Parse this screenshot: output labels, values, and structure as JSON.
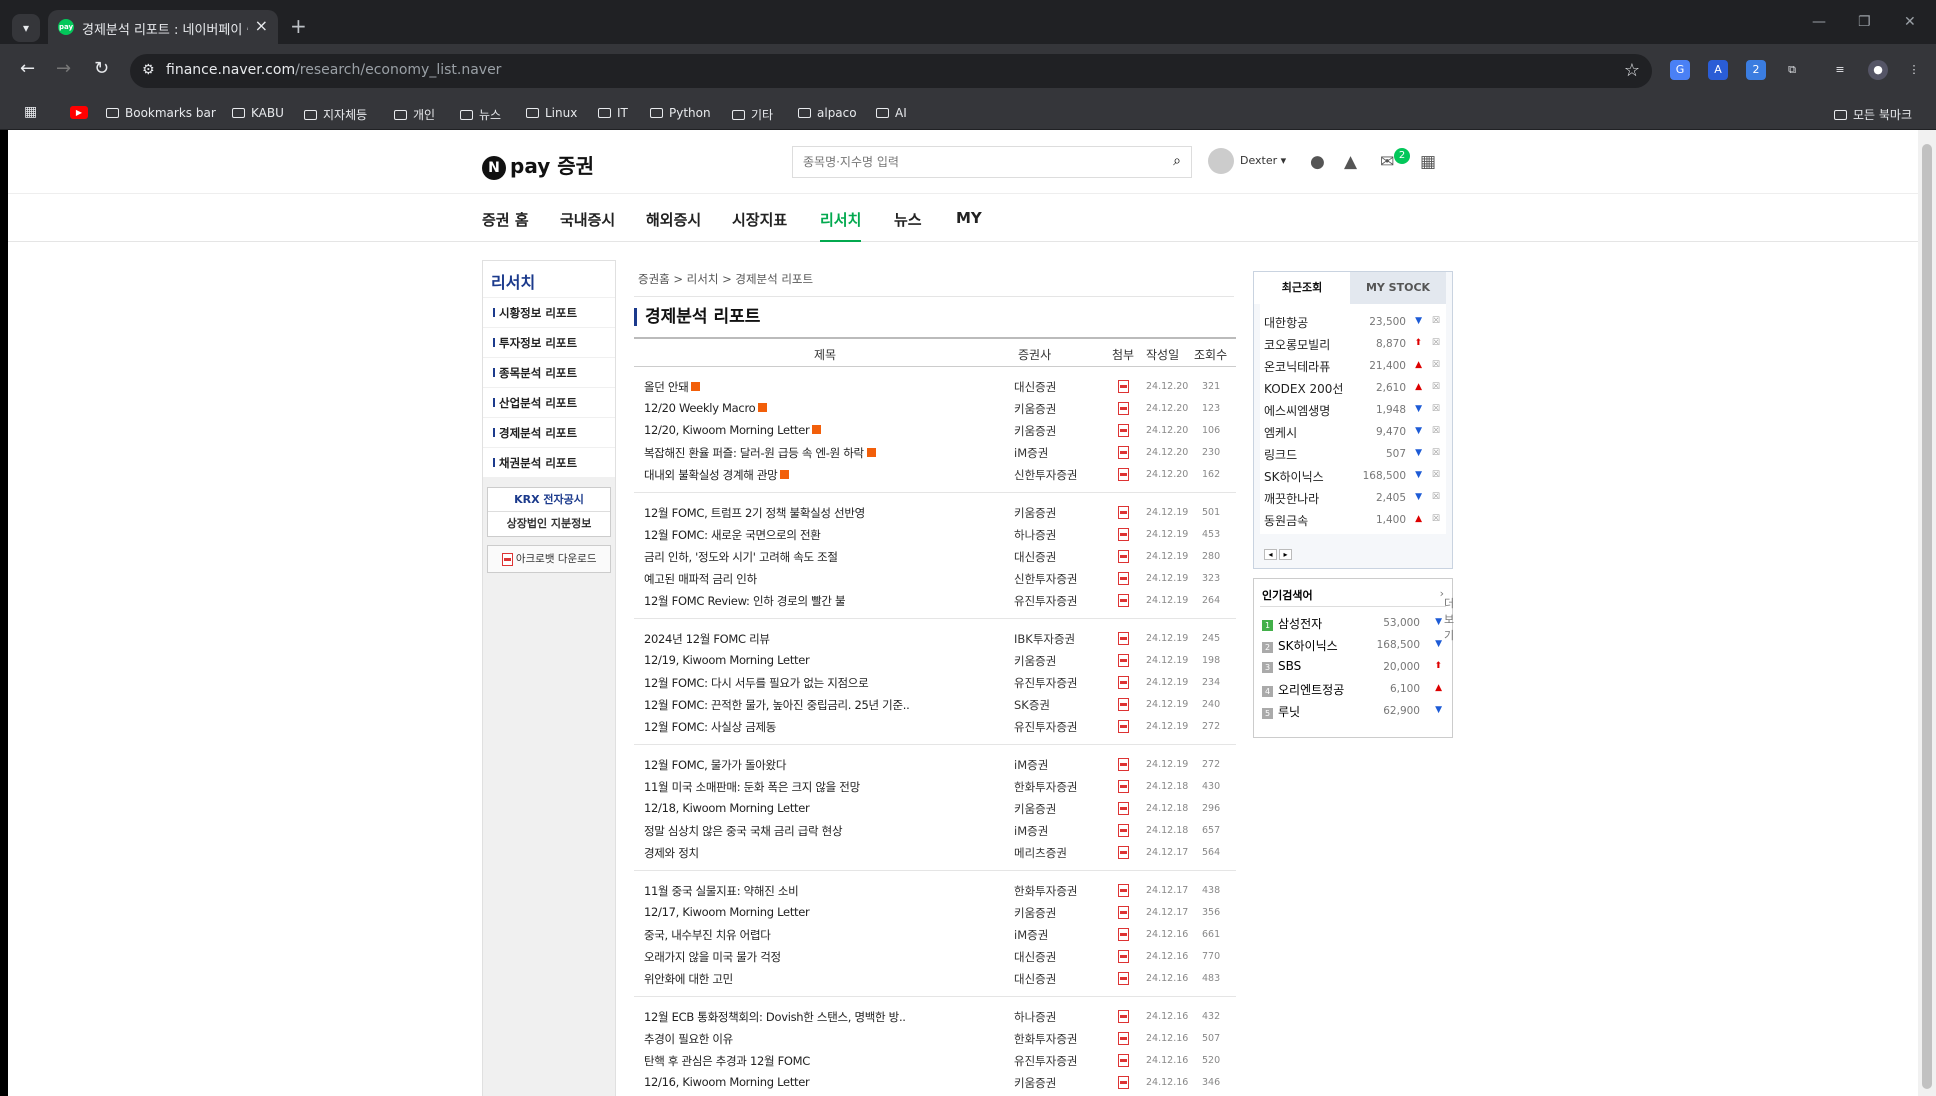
{
  "browser": {
    "tab_title": "경제분석 리포트 : 네이버페이 증권",
    "url_host": "finance.naver.com",
    "url_path": "/research/economy_list.naver",
    "bookmarks": [
      "Bookmarks bar",
      "KABU",
      "지자체등",
      "개인",
      "뉴스",
      "Linux",
      "IT",
      "Python",
      "기타",
      "alpaco",
      "AI"
    ],
    "bookmarks_right": "모든 북마크"
  },
  "header": {
    "logo": "pay 증권",
    "search_placeholder": "종목명·지수명 입력",
    "user": "Dexter",
    "mail_badge": "2"
  },
  "gnb": [
    "증권 홈",
    "국내증시",
    "해외증시",
    "시장지표",
    "리서치",
    "뉴스",
    "MY"
  ],
  "lnb": {
    "title": "리서치",
    "items": [
      "시황정보 리포트",
      "투자정보 리포트",
      "종목분석 리포트",
      "산업분석 리포트",
      "경제분석 리포트",
      "채권분석 리포트"
    ],
    "krx": "KRX 전자공시",
    "listed": "상장법인 지분정보",
    "acrobat": "아크로뱃 다운로드"
  },
  "breadcrumb": "증권홈 > 리서치 > 경제분석 리포트",
  "page_title": "경제분석 리포트",
  "table": {
    "headers": [
      "제목",
      "증권사",
      "첨부",
      "작성일",
      "조회수"
    ],
    "groups": [
      [
        {
          "t": "올던 안돼",
          "b": "대신증권",
          "d": "24.12.20",
          "v": "321",
          "n": true
        },
        {
          "t": "12/20 Weekly Macro",
          "b": "키움증권",
          "d": "24.12.20",
          "v": "123",
          "n": true
        },
        {
          "t": "12/20, Kiwoom Morning Letter",
          "b": "키움증권",
          "d": "24.12.20",
          "v": "106",
          "n": true
        },
        {
          "t": "복잡해진 환율 퍼즐: 달러-원 급등 속 엔-원 하락",
          "b": "iM증권",
          "d": "24.12.20",
          "v": "230",
          "n": true
        },
        {
          "t": "대내외 불확실성 경계해 관망",
          "b": "신한투자증권",
          "d": "24.12.20",
          "v": "162",
          "n": true
        }
      ],
      [
        {
          "t": "12월 FOMC, 트럼프 2기 정책 불확실성 선반영",
          "b": "키움증권",
          "d": "24.12.19",
          "v": "501"
        },
        {
          "t": "12월 FOMC: 새로운 국면으로의 전환",
          "b": "하나증권",
          "d": "24.12.19",
          "v": "453"
        },
        {
          "t": "금리 인하, '정도와 시기' 고려해 속도 조절",
          "b": "대신증권",
          "d": "24.12.19",
          "v": "280"
        },
        {
          "t": "예고된 매파적 금리 인하",
          "b": "신한투자증권",
          "d": "24.12.19",
          "v": "323"
        },
        {
          "t": "12월 FOMC Review: 인하 경로의 빨간 불",
          "b": "유진투자증권",
          "d": "24.12.19",
          "v": "264"
        }
      ],
      [
        {
          "t": "2024년 12월 FOMC 리뷰",
          "b": "IBK투자증권",
          "d": "24.12.19",
          "v": "245"
        },
        {
          "t": "12/19, Kiwoom Morning Letter",
          "b": "키움증권",
          "d": "24.12.19",
          "v": "198"
        },
        {
          "t": "12월 FOMC: 다시 서두를 필요가 없는 지점으로",
          "b": "유진투자증권",
          "d": "24.12.19",
          "v": "234"
        },
        {
          "t": "12월 FOMC: 끈적한 물가, 높아진 중립금리. 25년 기준..",
          "b": "SK증권",
          "d": "24.12.19",
          "v": "240"
        },
        {
          "t": "12월 FOMC: 사실상 금제동",
          "b": "유진투자증권",
          "d": "24.12.19",
          "v": "272"
        }
      ],
      [
        {
          "t": "12월 FOMC, 물가가 돌아왔다",
          "b": "iM증권",
          "d": "24.12.19",
          "v": "272"
        },
        {
          "t": "11월 미국 소매판매: 둔화 폭은 크지 않을 전망",
          "b": "한화투자증권",
          "d": "24.12.18",
          "v": "430"
        },
        {
          "t": "12/18, Kiwoom Morning Letter",
          "b": "키움증권",
          "d": "24.12.18",
          "v": "296"
        },
        {
          "t": "정말 심상치 않은 중국 국채 금리 급락 현상",
          "b": "iM증권",
          "d": "24.12.18",
          "v": "657"
        },
        {
          "t": "경제와 정치",
          "b": "메리츠증권",
          "d": "24.12.17",
          "v": "564"
        }
      ],
      [
        {
          "t": "11월 중국 실물지표: 약해진 소비",
          "b": "한화투자증권",
          "d": "24.12.17",
          "v": "438"
        },
        {
          "t": "12/17, Kiwoom Morning Letter",
          "b": "키움증권",
          "d": "24.12.17",
          "v": "356"
        },
        {
          "t": "중국, 내수부진 치유 어렵다",
          "b": "iM증권",
          "d": "24.12.16",
          "v": "661"
        },
        {
          "t": "오래가지 않을 미국 물가 걱정",
          "b": "대신증권",
          "d": "24.12.16",
          "v": "770"
        },
        {
          "t": "위안화에 대한 고민",
          "b": "대신증권",
          "d": "24.12.16",
          "v": "483"
        }
      ],
      [
        {
          "t": "12월 ECB 통화정책회의: Dovish한 스탠스, 명백한 방..",
          "b": "하나증권",
          "d": "24.12.16",
          "v": "432"
        },
        {
          "t": "추경이 필요한 이유",
          "b": "한화투자증권",
          "d": "24.12.16",
          "v": "507"
        },
        {
          "t": "탄핵 후 관심은 추경과 12월 FOMC",
          "b": "유진투자증권",
          "d": "24.12.16",
          "v": "520"
        },
        {
          "t": "12/16, Kiwoom Morning Letter",
          "b": "키움증권",
          "d": "24.12.16",
          "v": "346"
        }
      ]
    ]
  },
  "recent": {
    "tab_active": "최근조회",
    "tab_other": "MY STOCK",
    "items": [
      {
        "n": "대한항공",
        "p": "23,500",
        "dir": "dn"
      },
      {
        "n": "코오롱모빌리",
        "p": "8,870",
        "dir": "upb"
      },
      {
        "n": "온코닉테라퓨",
        "p": "21,400",
        "dir": "up"
      },
      {
        "n": "KODEX 200선",
        "p": "2,610",
        "dir": "up"
      },
      {
        "n": "에스씨엠생명",
        "p": "1,948",
        "dir": "dn"
      },
      {
        "n": "엠케시",
        "p": "9,470",
        "dir": "dn"
      },
      {
        "n": "링크드",
        "p": "507",
        "dir": "dn"
      },
      {
        "n": "SK하이닉스",
        "p": "168,500",
        "dir": "dn"
      },
      {
        "n": "깨끗한나라",
        "p": "2,405",
        "dir": "dn"
      },
      {
        "n": "동원금속",
        "p": "1,400",
        "dir": "up"
      }
    ]
  },
  "popular": {
    "title": "인기검색어",
    "more": "더보기",
    "items": [
      {
        "r": "1",
        "n": "삼성전자",
        "p": "53,000",
        "dir": "dn"
      },
      {
        "r": "2",
        "n": "SK하이닉스",
        "p": "168,500",
        "dir": "dn"
      },
      {
        "r": "3",
        "n": "SBS",
        "p": "20,000",
        "dir": "upb"
      },
      {
        "r": "4",
        "n": "오리엔트정공",
        "p": "6,100",
        "dir": "up"
      },
      {
        "r": "5",
        "n": "루닛",
        "p": "62,900",
        "dir": "dn"
      }
    ]
  }
}
